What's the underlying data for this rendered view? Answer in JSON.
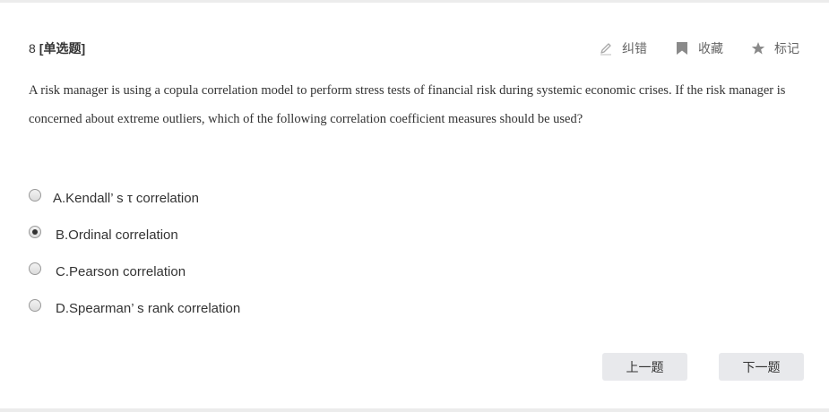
{
  "question": {
    "number": "8",
    "type": "[单选题]",
    "text": "A risk manager is using a copula correlation model to perform stress tests of financial risk during systemic economic crises. If the risk manager is concerned about extreme outliers, which of the following correlation coefficient measures should be used?"
  },
  "tools": {
    "report": {
      "label": "纠错",
      "icon": "pencil-icon"
    },
    "favorite": {
      "label": "收藏",
      "icon": "bookmark-icon"
    },
    "mark": {
      "label": "标记",
      "icon": "star-icon"
    }
  },
  "options": [
    {
      "label": "A.Kendall’ s τ correlation",
      "selected": false
    },
    {
      "label": "B.Ordinal correlation",
      "selected": true
    },
    {
      "label": "C.Pearson correlation",
      "selected": false
    },
    {
      "label": "D.Spearman’ s rank correlation",
      "selected": false
    }
  ],
  "nav": {
    "prev_label": "上一题",
    "next_label": "下一题"
  },
  "colors": {
    "text": "#333333",
    "tool_text": "#666666",
    "icon": "#999999",
    "button_bg": "#e8e9ec"
  }
}
